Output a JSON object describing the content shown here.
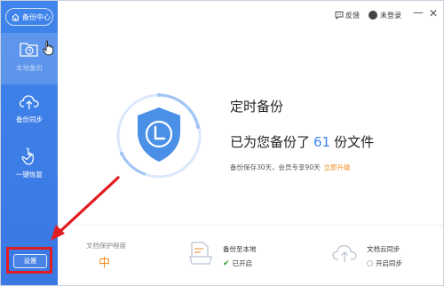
{
  "app": {
    "title": "备份中心"
  },
  "sidebar": {
    "items": [
      {
        "label": "本地备份",
        "icon": "folder-clock-icon",
        "active": true
      },
      {
        "label": "备份同步",
        "icon": "cloud-upload-icon",
        "active": false
      },
      {
        "label": "一键恢复",
        "icon": "hand-restore-icon",
        "active": false
      }
    ],
    "settings_label": "设置"
  },
  "topbar": {
    "feedback_label": "反馈",
    "user_label": "未登录"
  },
  "main": {
    "title": "定时备份",
    "count_prefix": "已为您备份了",
    "count_value": "61",
    "count_suffix": "份文件",
    "retention_text": "备份保存30天，会员专享90天",
    "upgrade_link": "立即升级"
  },
  "stats": {
    "protection_label": "文档保护程度",
    "protection_level": "中",
    "local_backup_label": "备份至本地",
    "local_backup_status": "已开启",
    "cloud_sync_label": "文档云同步",
    "cloud_sync_status": "开启同步"
  },
  "colors": {
    "sidebar": "#3f84ea",
    "accent_blue": "#3b86f0",
    "accent_orange": "#f08b1c",
    "highlight_red": "#e21d22",
    "shield": "#4a90e6"
  }
}
